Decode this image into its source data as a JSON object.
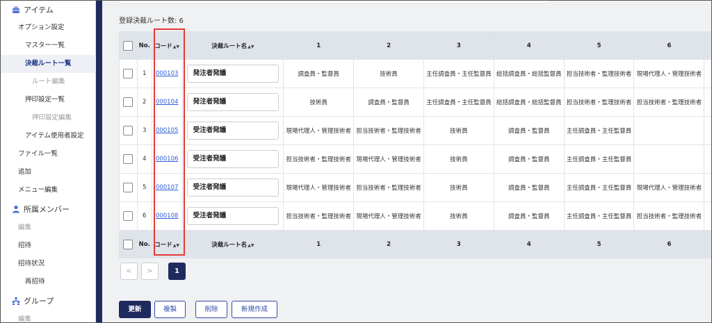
{
  "sidebar": {
    "items": [
      {
        "label": "アイテム",
        "icon": "toolbox-icon"
      },
      {
        "label": "オプション設定"
      },
      {
        "label": "マスター一覧"
      },
      {
        "label": "決裁ルート一覧"
      },
      {
        "label": "ルート編集"
      },
      {
        "label": "押印設定一覧"
      },
      {
        "label": "押印設定編集"
      },
      {
        "label": "アイテム使用者設定"
      },
      {
        "label": "ファイル一覧"
      },
      {
        "label": "追加"
      },
      {
        "label": "メニュー編集"
      },
      {
        "label": "所属メンバー",
        "icon": "user-icon"
      },
      {
        "label": "編集"
      },
      {
        "label": "招待"
      },
      {
        "label": "招待状況"
      },
      {
        "label": "再招待"
      },
      {
        "label": "グループ",
        "icon": "group-icon"
      },
      {
        "label": "編集"
      }
    ]
  },
  "main": {
    "count_label": "登録決裁ルート数: 6",
    "table": {
      "headers": {
        "no": "No.",
        "code": "コード",
        "name": "決裁ルート名",
        "cols": [
          "1",
          "2",
          "3",
          "4",
          "5",
          "6"
        ]
      },
      "rows": [
        {
          "no": "1",
          "code": "000103",
          "name": "発注者発議",
          "cells": [
            "調査員・監督員",
            "技術員",
            "主任調査員・主任監督員",
            "総括調査員・総括監督員",
            "担当技術者・監理技術者",
            "現場代理人・管理技術者"
          ]
        },
        {
          "no": "2",
          "code": "000104",
          "name": "発注者発議",
          "cells": [
            "技術員",
            "調査員・監督員",
            "主任調査員・主任監督員",
            "総括調査員・総括監督員",
            "担当技術者・監理技術者",
            "担当技術者・監理技術者"
          ]
        },
        {
          "no": "3",
          "code": "000105",
          "name": "受注者発議",
          "cells": [
            "現場代理人・管理技術者",
            "担当技術者・監理技術者",
            "技術員",
            "調査員・監督員",
            "主任調査員・主任監督員",
            ""
          ]
        },
        {
          "no": "4",
          "code": "000106",
          "name": "受注者発議",
          "cells": [
            "担当技術者・監理技術者",
            "現場代理人・管理技術者",
            "技術員",
            "調査員・監督員",
            "主任調査員・主任監督員",
            ""
          ]
        },
        {
          "no": "5",
          "code": "000107",
          "name": "受注者発議",
          "cells": [
            "現場代理人・管理技術者",
            "担当技術者・監理技術者",
            "技術員",
            "調査員・監督員",
            "主任調査員・主任監督員",
            "現場代理人・管理技術者"
          ]
        },
        {
          "no": "6",
          "code": "000108",
          "name": "受注者発議",
          "cells": [
            "担当技術者・監理技術者",
            "現場代理人・管理技術者",
            "技術員",
            "調査員・監督員",
            "主任調査員・主任監督員",
            "担当技術者・監理技術者"
          ]
        }
      ]
    },
    "pagination": {
      "prev": "<",
      "next": ">",
      "current": "1"
    },
    "actions": {
      "update": "更新",
      "duplicate": "複製",
      "delete": "削除",
      "create": "新規作成"
    }
  },
  "colors": {
    "navy": "#1f2a5e",
    "link": "#2b5bd7",
    "highlight": "#e53935"
  }
}
